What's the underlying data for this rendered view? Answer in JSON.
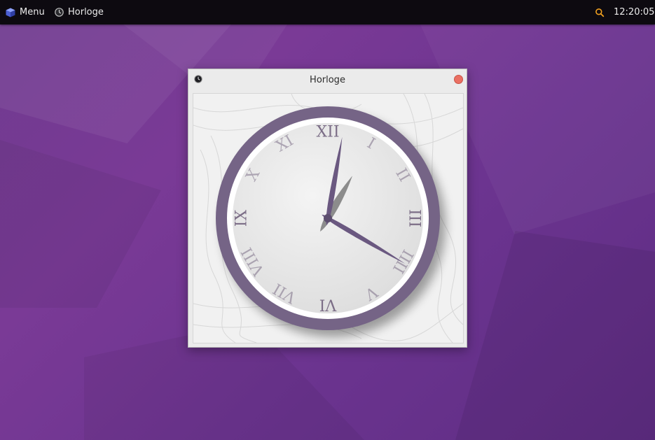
{
  "panel": {
    "menu_label": "Menu",
    "menu_icon": "cube-icon",
    "taskbar_app_label": "Horloge",
    "taskbar_app_icon": "clock-icon",
    "search_icon": "search-icon",
    "clock_text": "12:20:05"
  },
  "window": {
    "title": "Horloge",
    "app_icon": "clock-icon",
    "close_icon": "close-icon"
  },
  "clock": {
    "numerals": [
      "XII",
      "I",
      "II",
      "III",
      "IIII",
      "V",
      "VI",
      "VII",
      "VIII",
      "IX",
      "X",
      "XI"
    ],
    "hours": 12,
    "minutes": 20,
    "seconds": 5,
    "colors": {
      "rim": "#756486",
      "hands": "#6a5880",
      "numerals": "#7c6e87",
      "dial": "#ececec",
      "accent_search": "#f0a020",
      "close": "#ea7063"
    }
  }
}
